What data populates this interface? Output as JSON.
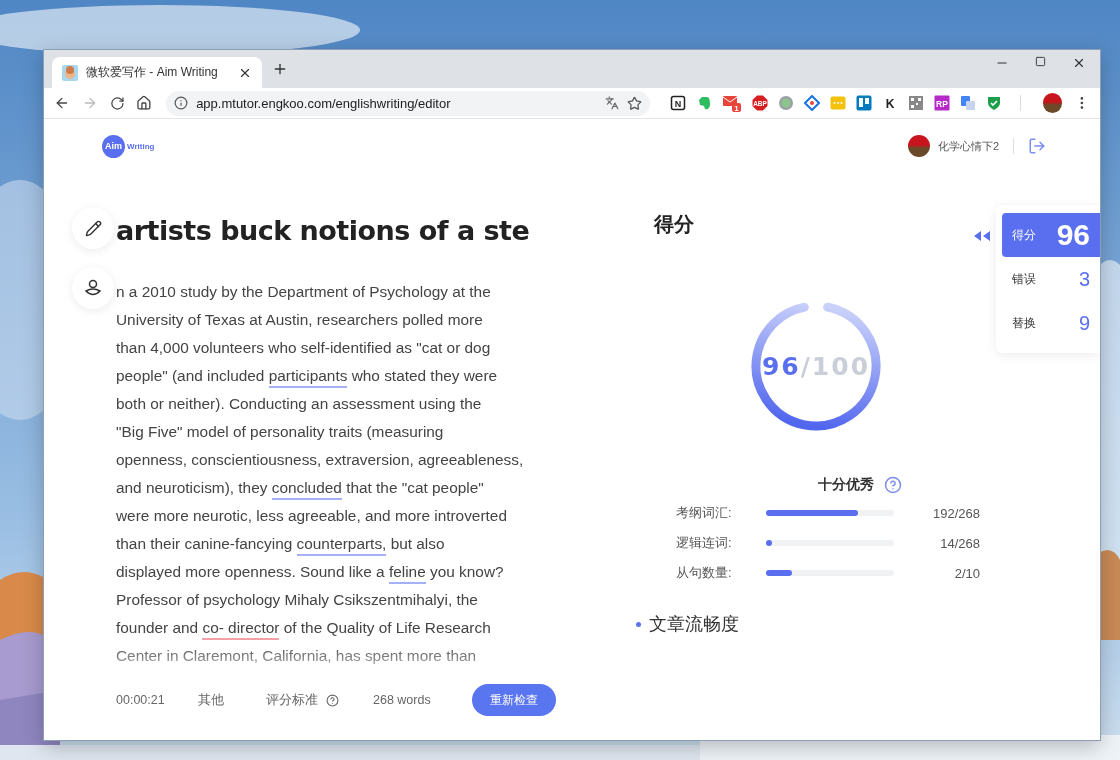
{
  "browser": {
    "tab": {
      "title": "微软爱写作 - Aim Writing"
    },
    "forward_disabled": true,
    "url": "app.mtutor.engkoo.com/englishwriting/editor",
    "extensions": [
      {
        "kind": "notion",
        "label": "N"
      },
      {
        "kind": "evernote"
      },
      {
        "kind": "mail",
        "badge": "1"
      },
      {
        "kind": "abp",
        "label": "ABP"
      },
      {
        "kind": "dot"
      },
      {
        "kind": "diamond"
      },
      {
        "kind": "dots"
      },
      {
        "kind": "trello"
      },
      {
        "kind": "letter",
        "label": "K"
      },
      {
        "kind": "qr"
      },
      {
        "kind": "rp",
        "label": "RP"
      },
      {
        "kind": "translate"
      },
      {
        "kind": "shield"
      }
    ]
  },
  "header": {
    "logo": {
      "mark": "Aim",
      "text": "Writing"
    },
    "user": {
      "name": "化学心情下2"
    }
  },
  "essay": {
    "title": "artists buck notions of a ste",
    "lines": [
      [
        {
          "kind": "plain",
          "text": "n a 2010 study by the Department of Psychology at the"
        }
      ],
      [
        {
          "kind": "plain",
          "text": "University of Texas at Austin, researchers polled more"
        }
      ],
      [
        {
          "kind": "plain",
          "text": "than 4,000 volunteers who self-identified as \"cat or dog"
        }
      ],
      [
        {
          "kind": "plain",
          "text": "people\" (and included "
        },
        {
          "kind": "suggestion",
          "text": "participants"
        },
        {
          "kind": "plain",
          "text": " who stated they were"
        }
      ],
      [
        {
          "kind": "plain",
          "text": "both or neither). Conducting an assessment using the"
        }
      ],
      [
        {
          "kind": "plain",
          "text": "\"Big Five\" model of personality traits (measuring"
        }
      ],
      [
        {
          "kind": "plain",
          "text": "openness, conscientiousness, extraversion, agreeableness,"
        }
      ],
      [
        {
          "kind": "plain",
          "text": "and neuroticism), they "
        },
        {
          "kind": "suggestion",
          "text": "concluded"
        },
        {
          "kind": "plain",
          "text": " that the \"cat people\""
        }
      ],
      [
        {
          "kind": "plain",
          "text": "were more neurotic, less agreeable, and more introverted"
        }
      ],
      [
        {
          "kind": "plain",
          "text": "than their canine-fancying "
        },
        {
          "kind": "suggestion",
          "text": "counterparts,"
        },
        {
          "kind": "plain",
          "text": " but also"
        }
      ],
      [
        {
          "kind": "plain",
          "text": "displayed more openness. Sound like a "
        },
        {
          "kind": "suggestion",
          "text": "feline"
        },
        {
          "kind": "plain",
          "text": " you know?"
        }
      ],
      [
        {
          "kind": "plain",
          "text": "Professor of psychology Mihaly Csikszentmihalyi, the"
        }
      ],
      [
        {
          "kind": "plain",
          "text": "founder and "
        },
        {
          "kind": "error",
          "text": "co- director"
        },
        {
          "kind": "plain",
          "text": " of the Quality of Life Research"
        }
      ],
      [
        {
          "kind": "plain",
          "text": "Center in Claremont, California, has spent more than"
        }
      ]
    ]
  },
  "footer": {
    "timer": "00:00:21",
    "category": "其他",
    "rubric": "评分标准",
    "word_count": "268 words",
    "recheck_button": "重新检查"
  },
  "score": {
    "heading": "得分",
    "ring": {
      "score": "96",
      "total": "/100",
      "level": 0.96
    },
    "verdict": "十分优秀",
    "metrics": [
      {
        "label": "考纲词汇:",
        "level": 0.72,
        "reading": "192/268"
      },
      {
        "label": "逻辑连词:",
        "level": 0.05,
        "reading": "14/268"
      },
      {
        "label": "从句数量:",
        "level": 0.2,
        "reading": "2/10"
      }
    ],
    "section": "文章流畅度"
  },
  "summary_tabs": [
    {
      "label": "得分",
      "value": "96",
      "selected": true
    },
    {
      "label": "错误",
      "value": "3",
      "selected": false
    },
    {
      "label": "替换",
      "value": "9",
      "selected": false
    }
  ]
}
